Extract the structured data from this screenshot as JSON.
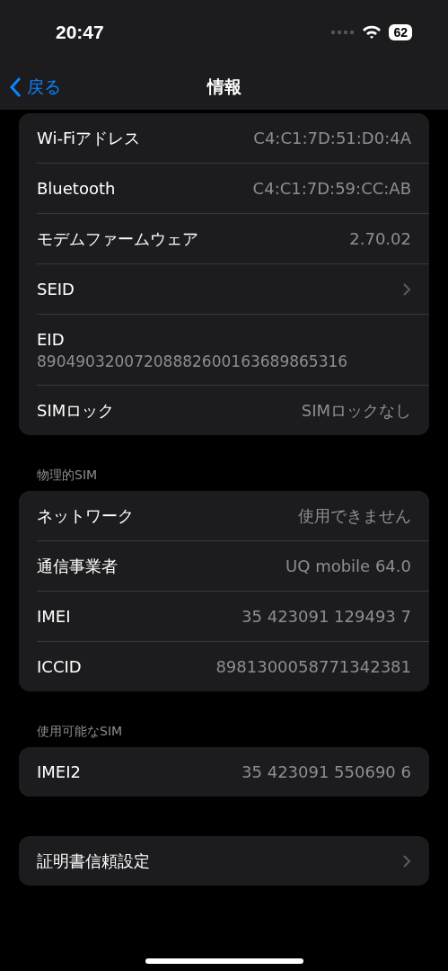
{
  "status_bar": {
    "time": "20:47",
    "battery": "62"
  },
  "nav": {
    "back": "戻る",
    "title": "情報"
  },
  "sections": [
    {
      "rows": [
        {
          "kind": "value",
          "label": "Wi-Fiアドレス",
          "value": "C4:C1:7D:51:D0:4A"
        },
        {
          "kind": "value",
          "label": "Bluetooth",
          "value": "C4:C1:7D:59:CC:AB"
        },
        {
          "kind": "value",
          "label": "モデムファームウェア",
          "value": "2.70.02"
        },
        {
          "kind": "chevron",
          "label": "SEID"
        },
        {
          "kind": "stacked",
          "label": "EID",
          "value": "89049032007208882600163689865316"
        },
        {
          "kind": "value",
          "label": "SIMロック",
          "value": "SIMロックなし"
        }
      ]
    },
    {
      "header": "物理的SIM",
      "rows": [
        {
          "kind": "value",
          "label": "ネットワーク",
          "value": "使用できません"
        },
        {
          "kind": "value",
          "label": "通信事業者",
          "value": "UQ mobile 64.0"
        },
        {
          "kind": "value",
          "label": "IMEI",
          "value": "35 423091 129493 7"
        },
        {
          "kind": "value",
          "label": "ICCID",
          "value": "8981300058771342381"
        }
      ]
    },
    {
      "header": "使用可能なSIM",
      "rows": [
        {
          "kind": "value",
          "label": "IMEI2",
          "value": "35 423091 550690 6"
        }
      ]
    },
    {
      "rows": [
        {
          "kind": "chevron",
          "label": "証明書信頼設定"
        }
      ]
    }
  ]
}
